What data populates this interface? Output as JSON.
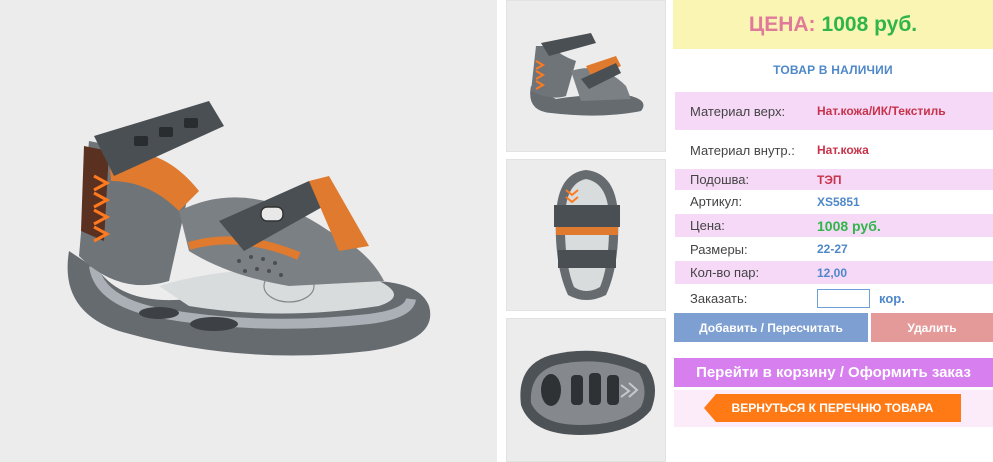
{
  "images": {
    "main_alt": "sandal-main-photo",
    "thumb1_alt": "sandal-side-view",
    "thumb2_alt": "sandal-top-view",
    "thumb3_alt": "sandal-sole-view"
  },
  "price_header": {
    "label": "ЦЕНА",
    "separator": ":",
    "value": "1008 руб."
  },
  "stock_status": "ТОВАР В НАЛИЧИИ",
  "specs": {
    "material_top": {
      "label": "Материал верх:",
      "value": "Нат.кожа/ИК/Текстиль"
    },
    "material_inner": {
      "label": "Материал внутр.:",
      "value": "Нат.кожа"
    },
    "sole": {
      "label": "Подошва:",
      "value": "ТЭП"
    },
    "article": {
      "label": "Артикул:",
      "value": "XS5851"
    },
    "price": {
      "label": "Цена:",
      "value": "1008 руб."
    },
    "sizes": {
      "label": "Размеры:",
      "value": "22-27"
    },
    "pairs": {
      "label": "Кол-во пар:",
      "value": "12,00"
    }
  },
  "order": {
    "label": "Заказать:",
    "value": "",
    "unit": "кор."
  },
  "buttons": {
    "add": "Добавить / Пересчитать",
    "delete": "Удалить",
    "cart": "Перейти в корзину / Оформить заказ",
    "back": "ВЕРНУТЬСЯ К ПЕРЕЧНЮ ТОВАРА"
  },
  "colors": {
    "accent_orange": "#ff7a14",
    "price_green": "#2fb54a",
    "label_pink": "#e07a9a",
    "row_shade": "#f5d9f7",
    "header_yellow": "#fbf5b4"
  }
}
